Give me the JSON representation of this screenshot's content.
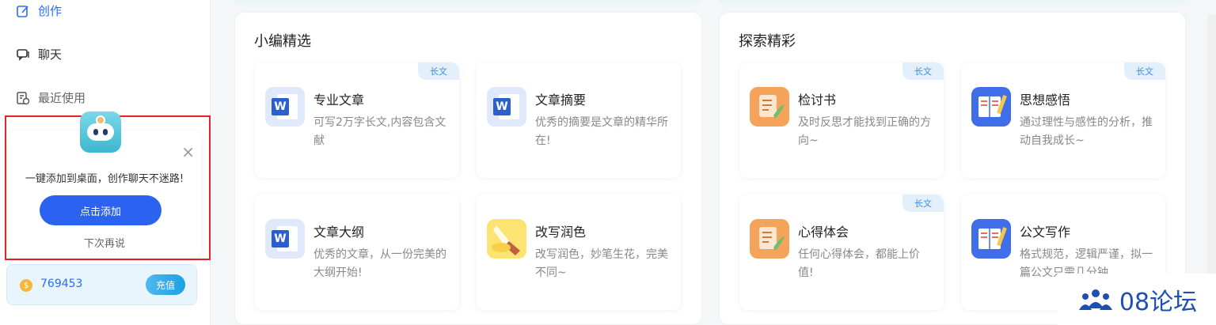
{
  "sidebar": {
    "nav": [
      {
        "label": "创作",
        "icon": "edit-icon"
      },
      {
        "label": "聊天",
        "icon": "chat-icon"
      },
      {
        "label": "最近使用",
        "icon": "history-icon"
      }
    ],
    "popup": {
      "message": "一键添加到桌面，创作聊天不迷路!",
      "add_button": "点击添加",
      "later": "下次再说",
      "close_icon": "close-icon"
    },
    "coins": {
      "value": "769453",
      "recharge_label": "充值"
    }
  },
  "panels": [
    {
      "title": "小编精选",
      "cards": [
        {
          "title": "专业文章",
          "desc": "可写2万字长文,内容包含文献",
          "tag": "长文",
          "icon": "word-icon"
        },
        {
          "title": "文章摘要",
          "desc": "优秀的摘要是文章的精华所在!",
          "tag": "",
          "icon": "word-icon"
        },
        {
          "title": "文章大纲",
          "desc": "优秀的文章，从一份完美的大纲开始!",
          "tag": "",
          "icon": "word-icon"
        },
        {
          "title": "改写润色",
          "desc": "改写润色，妙笔生花，完美不同~",
          "tag": "",
          "icon": "brush-icon"
        }
      ]
    },
    {
      "title": "探索精彩",
      "cards": [
        {
          "title": "检讨书",
          "desc": "及时反思才能找到正确的方向~",
          "tag": "长文",
          "icon": "scroll-quill-icon"
        },
        {
          "title": "思想感悟",
          "desc": "通过理性与感性的分析，推动自我成长~",
          "tag": "长文",
          "icon": "book-pencil-icon"
        },
        {
          "title": "心得体会",
          "desc": "任何心得体会，都能上价值!",
          "tag": "长文",
          "icon": "scroll-quill-icon"
        },
        {
          "title": "公文写作",
          "desc": "格式规范，逻辑严谨，拟一篇公文只需几分钟",
          "tag": "",
          "icon": "book-pencil-icon"
        }
      ]
    }
  ],
  "watermark": {
    "text": "08论坛"
  },
  "colors": {
    "accent": "#2b6cf5",
    "highlight": "#e0252b",
    "tag_bg": "#e3f0fc"
  }
}
